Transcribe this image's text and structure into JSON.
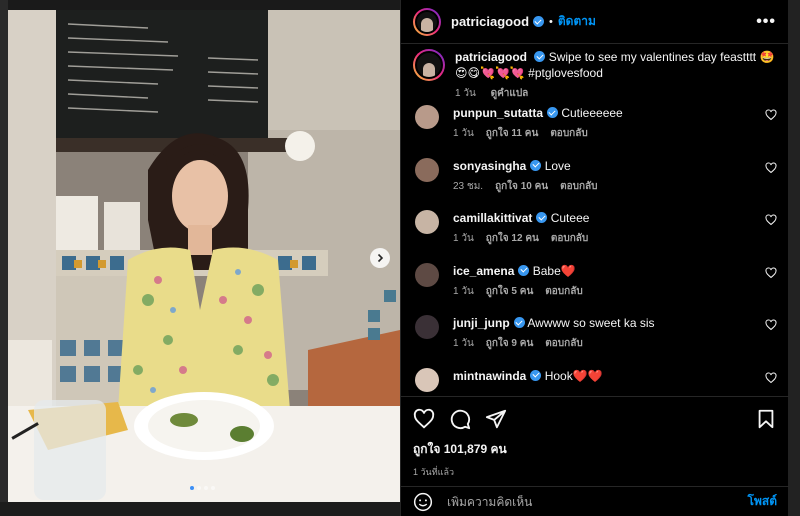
{
  "post": {
    "username": "patriciagood",
    "follow_label": "ติดตาม",
    "separator": "•",
    "more_icon": "more-horizontal-icon"
  },
  "caption": {
    "username": "patriciagood",
    "text": "Swipe to see my valentines day feastttt 🤩😍😋💘💘💘 #ptglovesfood",
    "age": "1 วัน",
    "translate": "ดูคำแปล"
  },
  "comments": [
    {
      "username": "punpun_sutatta",
      "text": "Cutieeeeee",
      "age": "1 วัน",
      "likes": "ถูกใจ 11 คน",
      "reply": "ตอบกลับ",
      "avatar_color": "#b89a8a"
    },
    {
      "username": "sonyasingha",
      "text": "Love",
      "age": "23 ชม.",
      "likes": "ถูกใจ 10 คน",
      "reply": "ตอบกลับ",
      "avatar_color": "#8a6b5c"
    },
    {
      "username": "camillakittivat",
      "text": "Cuteee",
      "age": "1 วัน",
      "likes": "ถูกใจ 12 คน",
      "reply": "ตอบกลับ",
      "avatar_color": "#c7b4a4"
    },
    {
      "username": "ice_amena",
      "text": "Babe❤️",
      "age": "1 วัน",
      "likes": "ถูกใจ 5 คน",
      "reply": "ตอบกลับ",
      "avatar_color": "#5e4a44"
    },
    {
      "username": "junji_junp",
      "text": "Awwww so sweet ka sis",
      "age": "1 วัน",
      "likes": "ถูกใจ 9 คน",
      "reply": "ตอบกลับ",
      "avatar_color": "#3a3036"
    },
    {
      "username": "mintnawinda",
      "text": "Hook❤️❤️",
      "age": "",
      "likes": "",
      "reply": "",
      "avatar_color": "#d9c6b8"
    }
  ],
  "actions": {
    "like_icon": "heart-icon",
    "comment_icon": "comment-icon",
    "share_icon": "send-icon",
    "save_icon": "bookmark-icon",
    "likes": "ถูกใจ 101,879 คน",
    "time": "1 วันที่แล้ว"
  },
  "add_comment": {
    "emoji_icon": "emoji-icon",
    "placeholder": "เพิ่มความคิดเห็น",
    "post_label": "โพสต์"
  },
  "carousel": {
    "slides": 4,
    "active": 0
  },
  "colors": {
    "accent": "#0095f6",
    "verified": "#3897f0",
    "panel_bg": "#000000",
    "muted": "#a8a8a8"
  }
}
